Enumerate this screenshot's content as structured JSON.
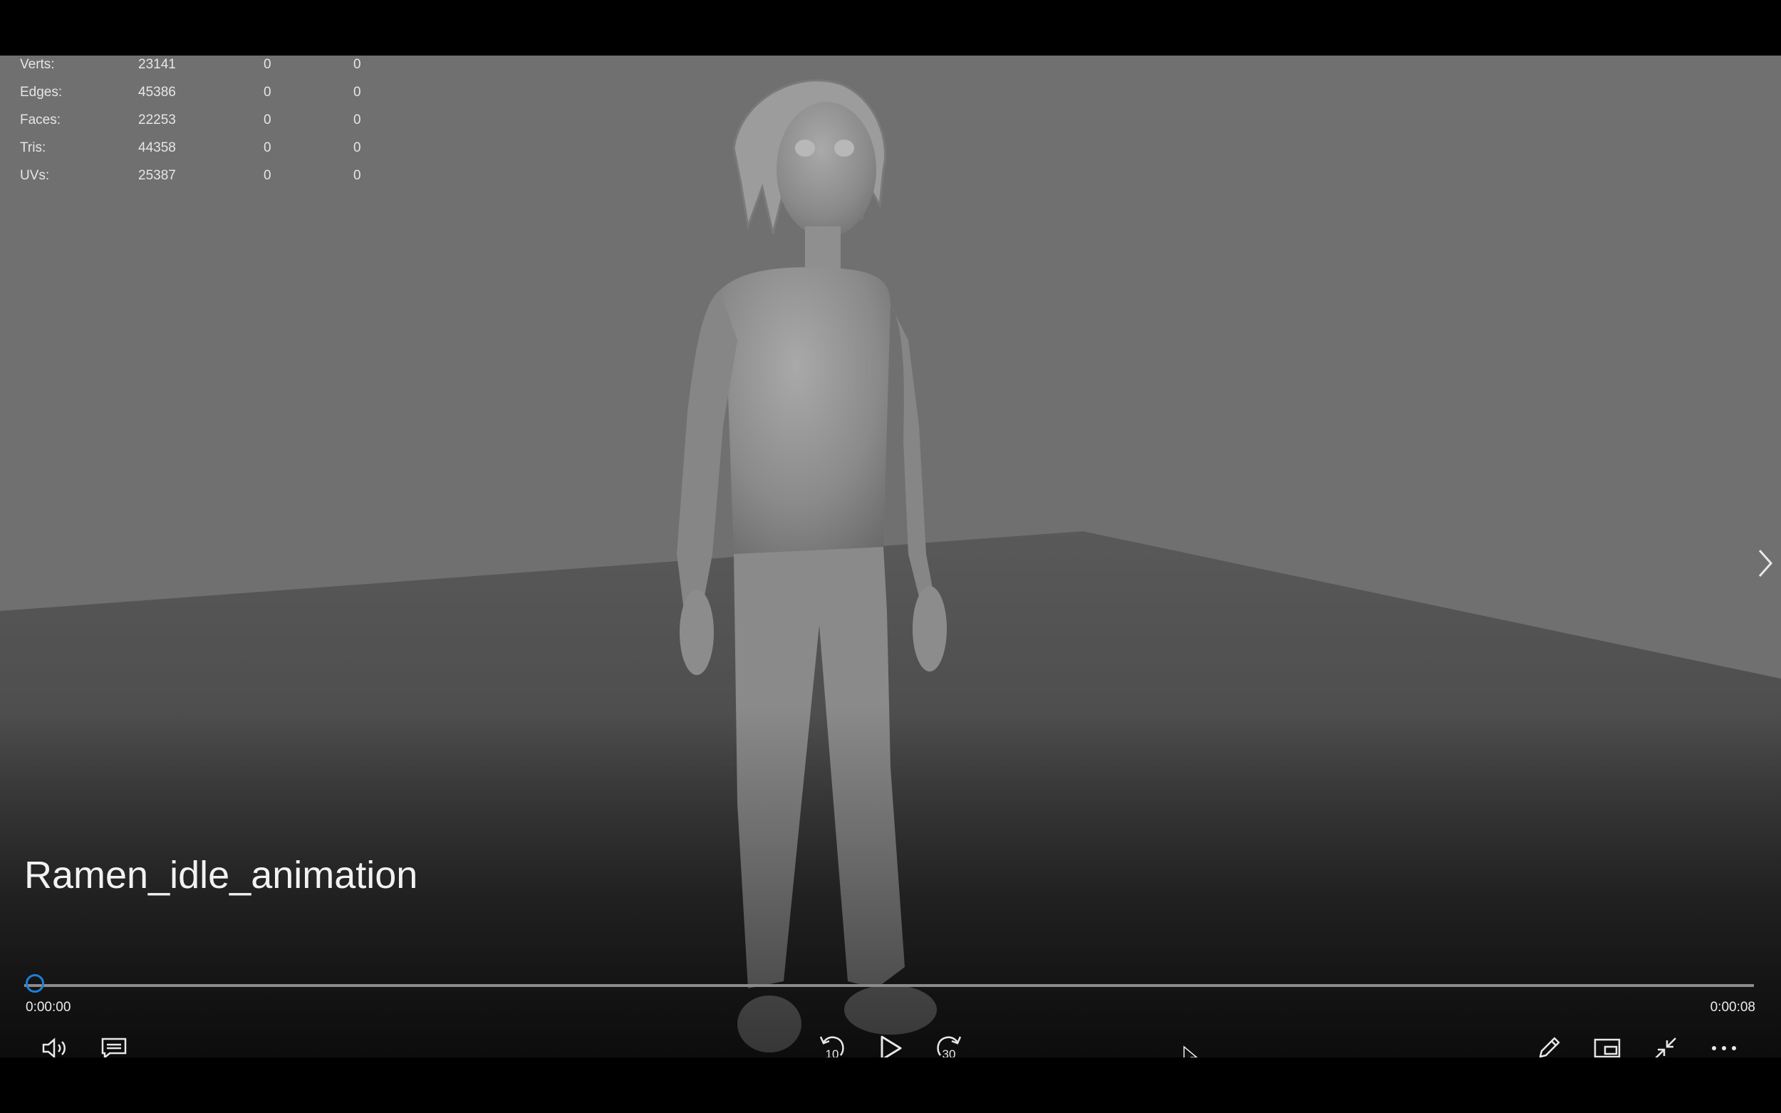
{
  "video": {
    "title": "Ramen_idle_animation",
    "progress": 0.0,
    "current_time": "0:00:00",
    "total_time": "0:00:08"
  },
  "stats": [
    {
      "label": "Verts:",
      "values": [
        "23141",
        "0",
        "0"
      ]
    },
    {
      "label": "Edges:",
      "values": [
        "45386",
        "0",
        "0"
      ]
    },
    {
      "label": "Faces:",
      "values": [
        "22253",
        "0",
        "0"
      ]
    },
    {
      "label": "Tris:",
      "values": [
        "44358",
        "0",
        "0"
      ]
    },
    {
      "label": "UVs:",
      "values": [
        "25387",
        "0",
        "0"
      ]
    }
  ],
  "controls": {
    "skip_back_seconds": "10",
    "skip_forward_seconds": "30"
  },
  "colors": {
    "accent": "#1e7fd8",
    "background_wall": "#6f6f6f",
    "floor": "#555555"
  }
}
